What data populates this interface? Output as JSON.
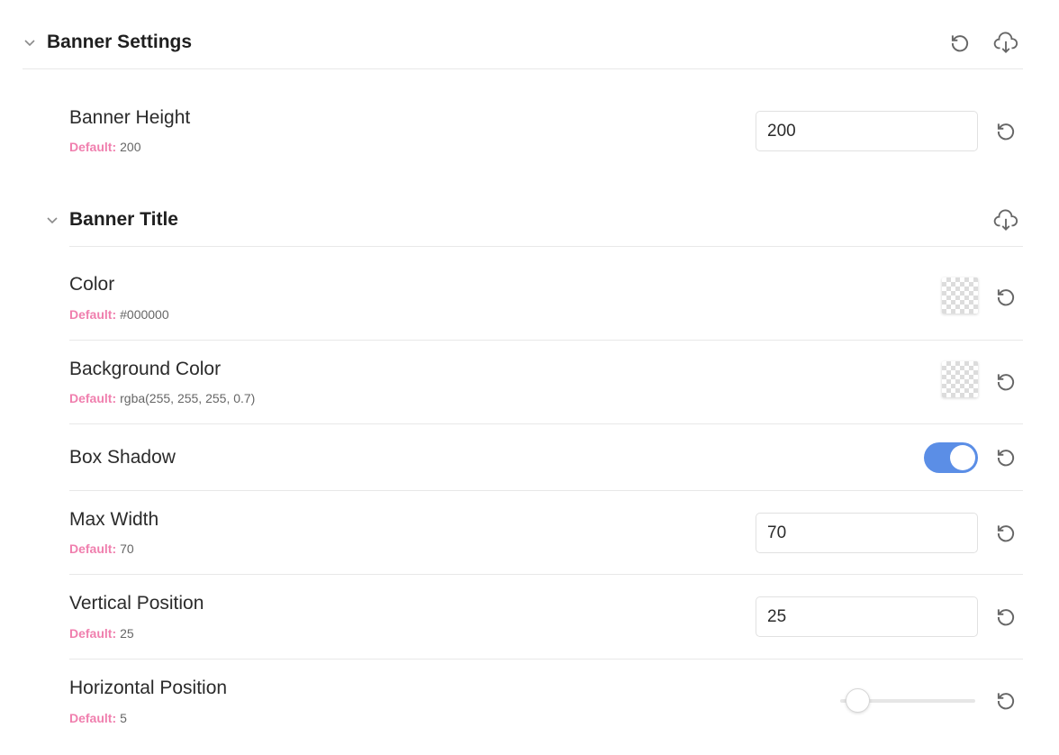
{
  "banner_settings": {
    "title": "Banner Settings",
    "reset_icon": "reset-icon",
    "export_icon": "cloud-download-icon"
  },
  "banner_height": {
    "label": "Banner Height",
    "default_key": "Default:",
    "default_value": "200",
    "value": "200"
  },
  "banner_title": {
    "title": "Banner Title",
    "export_icon": "cloud-download-icon"
  },
  "color": {
    "label": "Color",
    "default_key": "Default:",
    "default_value": "#000000"
  },
  "background_color": {
    "label": "Background Color",
    "default_key": "Default:",
    "default_value": "rgba(255, 255, 255, 0.7)"
  },
  "box_shadow": {
    "label": "Box Shadow",
    "enabled": true
  },
  "max_width": {
    "label": "Max Width",
    "default_key": "Default:",
    "default_value": "70",
    "value": "70"
  },
  "vertical_position": {
    "label": "Vertical Position",
    "default_key": "Default:",
    "default_value": "25",
    "value": "25"
  },
  "horizontal_position": {
    "label": "Horizontal Position",
    "default_key": "Default:",
    "default_value": "5",
    "slider_fraction": 0.05
  },
  "colors": {
    "accent": "#5b8ee6",
    "default_key": "#f07fae",
    "divider": "#e8e8e8"
  }
}
